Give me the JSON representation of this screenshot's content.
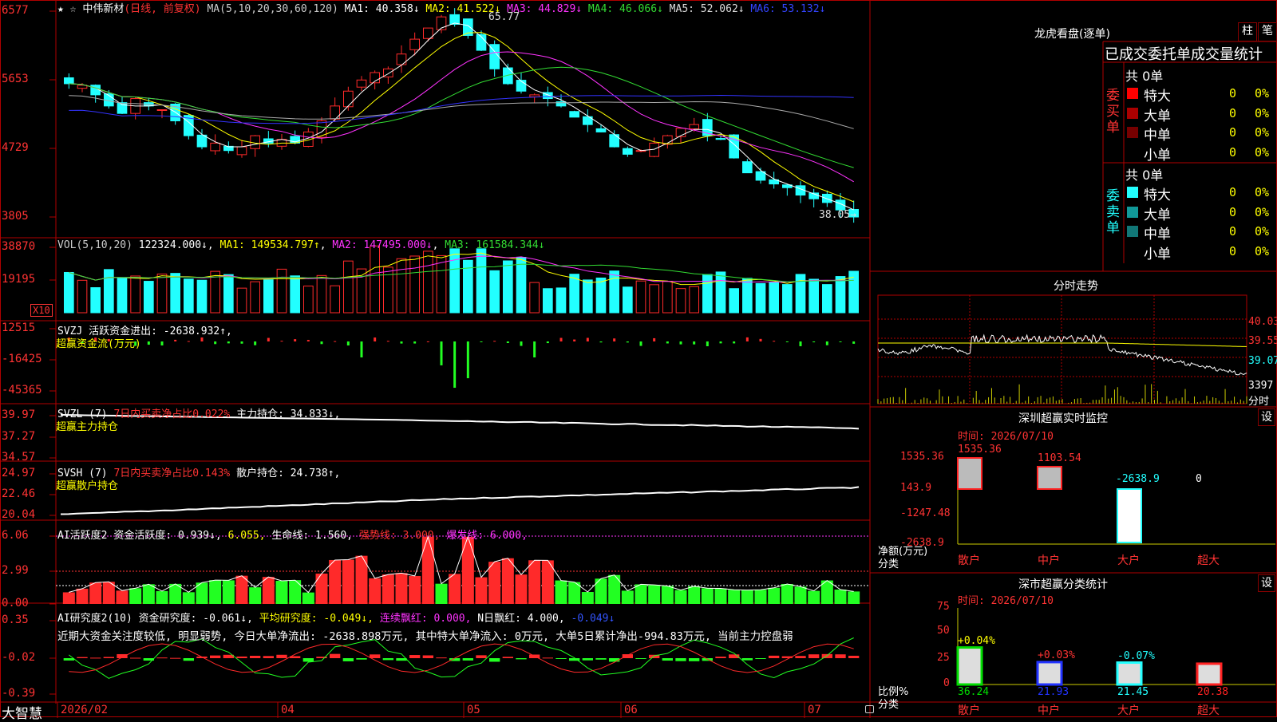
{
  "colors": {
    "up": "#ff2a2a",
    "down": "#22ffff",
    "grid": "#8b0000",
    "bg": "#000000",
    "ma1": "#ffffff",
    "ma2": "#ffff00",
    "ma3": "#ff33ff",
    "ma4": "#33dd33",
    "ma5": "#aaaaaa",
    "ma6": "#3333ff",
    "green": "#22ff22"
  },
  "footer": {
    "brand": "大智慧",
    "dates": [
      "2026/02",
      "04",
      "05",
      "06",
      "07"
    ]
  },
  "kline": {
    "title_star": "★ ☆",
    "stock": "中伟新材",
    "mode": "(日线, 前复权)",
    "ma_params": "MA(5,10,20,30,60,120)",
    "ma": [
      {
        "label": "MA1:",
        "value": "40.358↓",
        "color": "#ffffff"
      },
      {
        "label": "MA2:",
        "value": "41.522↓",
        "color": "#ffff00"
      },
      {
        "label": "MA3:",
        "value": "44.829↓",
        "color": "#ff33ff"
      },
      {
        "label": "MA4:",
        "value": "46.066↓",
        "color": "#33dd33"
      },
      {
        "label": "MA5:",
        "value": "52.062↓",
        "color": "#dddddd"
      },
      {
        "label": "MA6:",
        "value": "53.132↓",
        "color": "#3344ff"
      }
    ],
    "yticks": [
      "6577",
      "5653",
      "4729",
      "3805"
    ],
    "high_label": "65.77",
    "low_label": "38.05→"
  },
  "vol": {
    "header": "VOL(5,10,20)",
    "value": "122324.000↓",
    "ma1": "MA1: 149534.797↑",
    "ma2": "MA2: 147495.000↓",
    "ma3": "MA3: 161584.344↓",
    "yticks": [
      "38870",
      "19195"
    ],
    "unit": "X10"
  },
  "svzj": {
    "line1": "SVZJ  活跃资金进出: -2638.932↑,",
    "line2": "超赢资金流(万元)",
    "yticks": [
      "12515",
      "-16425",
      "-45365"
    ]
  },
  "svzl": {
    "name": "SVZL (7)",
    "red": "7日内买卖净占比0.022%",
    "white": "主力持仓: 34.833↓,",
    "line2": "超赢主力持仓",
    "yticks": [
      "39.97",
      "37.27",
      "34.57"
    ]
  },
  "svsh": {
    "name": "SVSH (7)",
    "red": "7日内买卖净占比0.143%",
    "white": "散户持仓: 24.738↑,",
    "line2": "超赢散户持仓",
    "yticks": [
      "24.97",
      "22.46",
      "20.04"
    ]
  },
  "ai1": {
    "name": "AI活跃度2",
    "parts": [
      {
        "t": "资金活跃度: 0.939↓, ",
        "c": "#ffffff"
      },
      {
        "t": "6.055, ",
        "c": "#ffff00"
      },
      {
        "t": "生命线: 1.560, ",
        "c": "#ffffff"
      },
      {
        "t": "强势线: 3.000, ",
        "c": "#ff3333"
      },
      {
        "t": "爆发线: 6.000,",
        "c": "#ff33ff"
      }
    ],
    "yticks": [
      "6.06",
      "2.99",
      "0.00"
    ]
  },
  "ai2": {
    "name": "AI研究度2(10)",
    "parts": [
      {
        "t": "资金研究度: -0.061↓, ",
        "c": "#ffffff"
      },
      {
        "t": "平均研究度: -0.049↓, ",
        "c": "#ffff00"
      },
      {
        "t": "连续飘红: 0.000, ",
        "c": "#ff33ff"
      },
      {
        "t": "N日飘红: 4.000, ",
        "c": "#ffffff"
      },
      {
        "t": "-0.049↓",
        "c": "#3355ff"
      }
    ],
    "comment": "近期大资金关注度较低, 明显弱势, 今日大单净流出: -2638.898万元, 其中特大单净流入: 0万元, 大单5日累计净出-994.83万元, 当前主力控盘弱",
    "yticks": [
      "0.35",
      "-0.02",
      "-0.39"
    ]
  },
  "right": {
    "lhb_title": "龙虎看盘(逐单)",
    "btn1": "柱",
    "btn2": "笔",
    "tabs": "已成交委托单成交量统计",
    "buy_side": "委买单",
    "sell_side": "委卖单",
    "total": "共 0单",
    "rows": [
      {
        "name": "特大",
        "count": "0",
        "pct": "0%"
      },
      {
        "name": "大单",
        "count": "0",
        "pct": "0%"
      },
      {
        "name": "中单",
        "count": "0",
        "pct": "0%"
      },
      {
        "name": "小单",
        "count": "0",
        "pct": "0%"
      }
    ],
    "intraday_title": "分时走势",
    "intraday_y": [
      "40.03",
      "39.55",
      "39.07",
      "3397",
      "分时"
    ],
    "monitor_title": "深圳超赢实时监控",
    "set": "设",
    "time": "时间: 2026/07/10",
    "mon_y": [
      "1535.36",
      "143.9",
      "-1247.48",
      "-2638.9"
    ],
    "mon_unit": "净额(万元)",
    "cls": "分类",
    "mon_bars": [
      {
        "cat": "散户",
        "val": "1535.36"
      },
      {
        "cat": "中户",
        "val": "1103.54"
      },
      {
        "cat": "大户",
        "val": "-2638.9"
      },
      {
        "cat": "超大",
        "val": "0"
      }
    ],
    "stat_title": "深市超赢分类统计",
    "stat_y": [
      "75",
      "50",
      "25",
      "0"
    ],
    "stat_unit": "比例%",
    "stat_bars": [
      {
        "cat": "散户",
        "pct": "+0.04%",
        "val": "36.24",
        "color": "#00dd00"
      },
      {
        "cat": "中户",
        "pct": "+0.03%",
        "val": "21.93",
        "color": "#2233ff"
      },
      {
        "cat": "大户",
        "pct": "-0.07%",
        "val": "21.45",
        "color": "#22ffff"
      },
      {
        "cat": "超大",
        "pct": "",
        "val": "20.38",
        "color": "#ff2222"
      }
    ]
  },
  "chart_data": {
    "type": "candlestick",
    "title": "中伟新材 (日线, 前复权)",
    "x_labels": [
      "2026/02",
      "04",
      "05",
      "06",
      "07"
    ],
    "price_ylim": [
      38.05,
      65.77
    ],
    "ohlc_approx_close": [
      56.0,
      55.8,
      54.5,
      53.0,
      52.0,
      54.0,
      53.0,
      52.5,
      51.0,
      49.0,
      47.5,
      48.0,
      47.0,
      47.5,
      49.0,
      48.0,
      48.5,
      48.0,
      49.5,
      51.0,
      53.0,
      55.0,
      56.5,
      57.5,
      58.0,
      60.0,
      62.0,
      63.5,
      65.0,
      64.0,
      62.5,
      60.5,
      58.0,
      56.0,
      55.0,
      54.5,
      54.0,
      53.0,
      51.5,
      50.5,
      49.5,
      47.5,
      46.5,
      47.0,
      48.0,
      49.0,
      50.0,
      50.5,
      49.0,
      48.5,
      46.0,
      44.0,
      43.0,
      42.5,
      42.0,
      41.0,
      40.5,
      40.0,
      39.0,
      38.05
    ],
    "ma": {
      "MA1": 40.358,
      "MA2": 41.522,
      "MA3": 44.829,
      "MA4": 46.066,
      "MA5": 52.062,
      "MA6": 53.132
    },
    "volume_ylim": [
      0,
      38870
    ],
    "svzl_ylim": [
      34.57,
      39.97
    ],
    "svsh_ylim": [
      20.04,
      24.97
    ],
    "ai_active_ylim": [
      0,
      6.06
    ],
    "ai_research_ylim": [
      -0.39,
      0.35
    ]
  }
}
